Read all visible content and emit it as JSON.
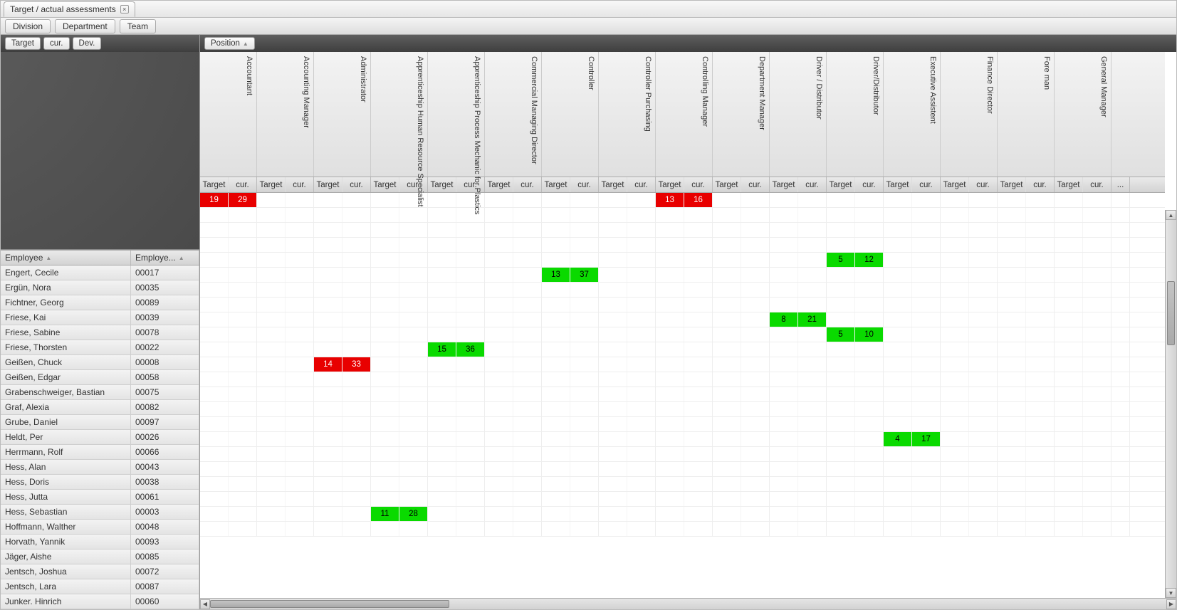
{
  "tab": {
    "title": "Target / actual assessments"
  },
  "toolbar": {
    "buttons": [
      "Division",
      "Department",
      "Team"
    ]
  },
  "left": {
    "chips": [
      "Target",
      "cur.",
      "Dev."
    ],
    "headers": {
      "employee": "Employee",
      "employee_no": "Employe..."
    }
  },
  "right": {
    "grouper": "Position",
    "subheaders": {
      "target": "Target",
      "cur": "cur.",
      "extra": "..."
    }
  },
  "positions": [
    "Accountant",
    "Accounting Manager",
    "Administrator",
    "Apprenticeship Human Resource Specialist",
    "Apprenticeship Process Mechanic for Plastics",
    "Commercial Managing Director",
    "Controller",
    "Controller Purchasing",
    "Controlling Manager",
    "Department Manager",
    "Driver / Distributor",
    "Driver/Distributor",
    "Executive Assistent",
    "Finance Director",
    "Fore man",
    "General Manager"
  ],
  "employees": [
    {
      "name": "Engert, Cecile",
      "no": "00017",
      "values": {
        "0": {
          "t": 19,
          "c": 29,
          "color": "red"
        },
        "8": {
          "t": 13,
          "c": 16,
          "color": "red"
        }
      }
    },
    {
      "name": "Ergün, Nora",
      "no": "00035",
      "values": {}
    },
    {
      "name": "Fichtner, Georg",
      "no": "00089",
      "values": {}
    },
    {
      "name": "Friese, Kai",
      "no": "00039",
      "values": {}
    },
    {
      "name": "Friese, Sabine",
      "no": "00078",
      "values": {
        "11": {
          "t": 5,
          "c": 12,
          "color": "green"
        }
      }
    },
    {
      "name": "Friese, Thorsten",
      "no": "00022",
      "values": {
        "6": {
          "t": 13,
          "c": 37,
          "color": "green"
        }
      }
    },
    {
      "name": "Geißen, Chuck",
      "no": "00008",
      "values": {}
    },
    {
      "name": "Geißen, Edgar",
      "no": "00058",
      "values": {}
    },
    {
      "name": "Grabenschweiger, Bastian",
      "no": "00075",
      "values": {
        "10": {
          "t": 8,
          "c": 21,
          "color": "green"
        }
      }
    },
    {
      "name": "Graf, Alexia",
      "no": "00082",
      "values": {
        "11": {
          "t": 5,
          "c": 10,
          "color": "green"
        }
      }
    },
    {
      "name": "Grube, Daniel",
      "no": "00097",
      "values": {
        "4": {
          "t": 15,
          "c": 36,
          "color": "green"
        }
      }
    },
    {
      "name": "Heldt, Per",
      "no": "00026",
      "values": {
        "2": {
          "t": 14,
          "c": 33,
          "color": "red"
        }
      }
    },
    {
      "name": "Herrmann, Rolf",
      "no": "00066",
      "values": {}
    },
    {
      "name": "Hess, Alan",
      "no": "00043",
      "values": {}
    },
    {
      "name": "Hess, Doris",
      "no": "00038",
      "values": {}
    },
    {
      "name": "Hess, Jutta",
      "no": "00061",
      "values": {}
    },
    {
      "name": "Hess, Sebastian",
      "no": "00003",
      "values": {
        "12": {
          "t": 4,
          "c": 17,
          "color": "green"
        }
      }
    },
    {
      "name": "Hoffmann, Walther",
      "no": "00048",
      "values": {}
    },
    {
      "name": "Horvath, Yannik",
      "no": "00093",
      "values": {}
    },
    {
      "name": "Jäger, Aishe",
      "no": "00085",
      "values": {}
    },
    {
      "name": "Jentsch, Joshua",
      "no": "00072",
      "values": {}
    },
    {
      "name": "Jentsch, Lara",
      "no": "00087",
      "values": {
        "3": {
          "t": 11,
          "c": 28,
          "color": "green"
        }
      }
    },
    {
      "name": "Junker. Hinrich",
      "no": "00060",
      "values": {}
    }
  ]
}
